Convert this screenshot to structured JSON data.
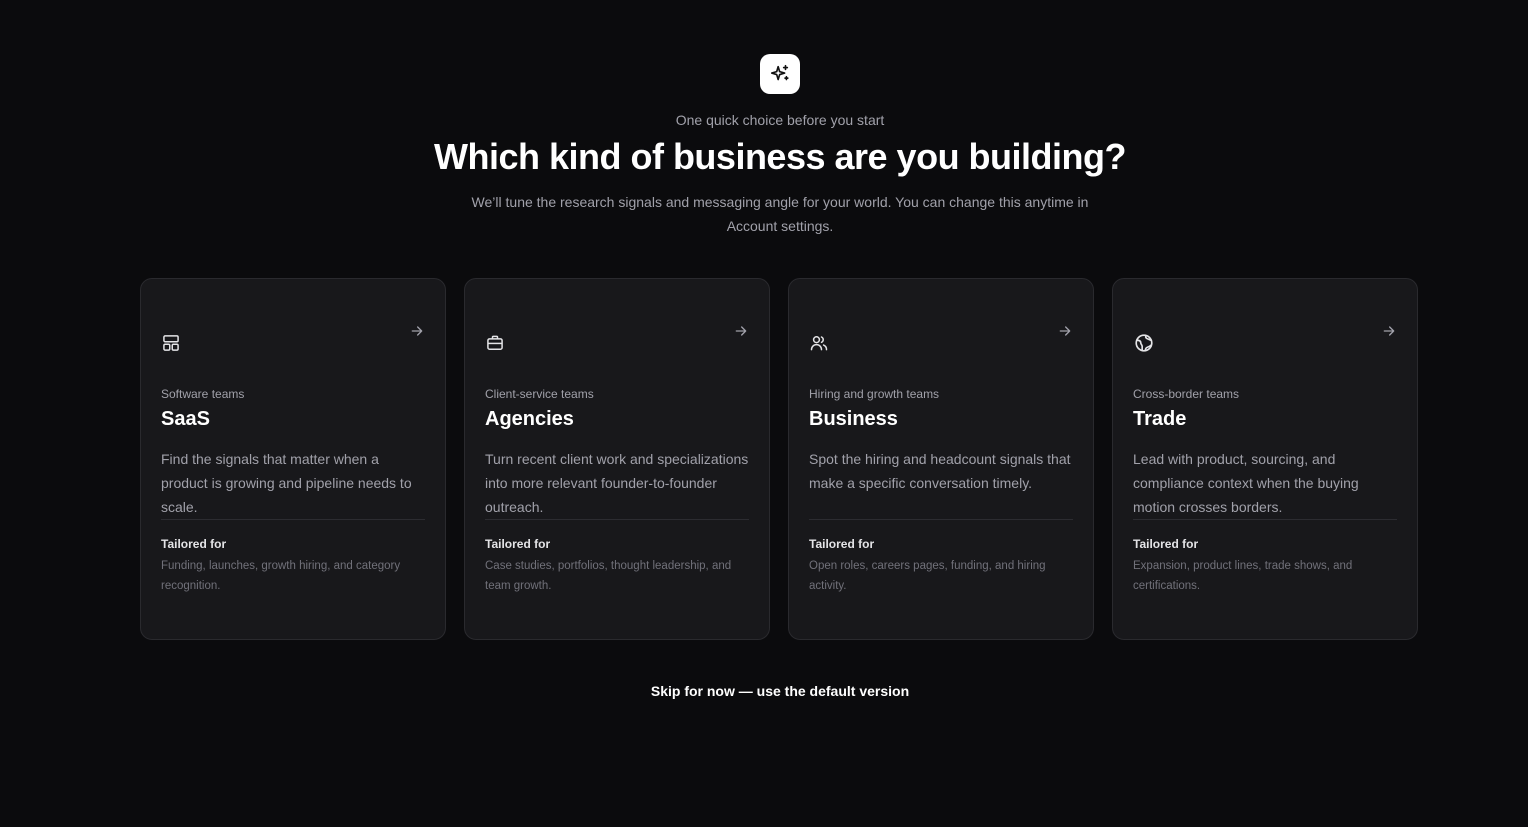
{
  "header": {
    "logo_icon": "sparkles-icon",
    "eyebrow": "One quick choice before you start",
    "title": "Which kind of business are you building?",
    "subtitle": "We’ll tune the research signals and messaging angle for your world. You can change this anytime in Account settings."
  },
  "cards": [
    {
      "icon": "layout-grid-icon",
      "kicker": "Software teams",
      "title": "SaaS",
      "description": "Find the signals that matter when a product is growing and pipeline needs to scale.",
      "tailored_label": "Tailored for",
      "tailored_text": "Funding, launches, growth hiring, and category recognition."
    },
    {
      "icon": "briefcase-icon",
      "kicker": "Client-service teams",
      "title": "Agencies",
      "description": "Turn recent client work and specializations into more relevant founder-to-founder outreach.",
      "tailored_label": "Tailored for",
      "tailored_text": "Case studies, portfolios, thought leadership, and team growth."
    },
    {
      "icon": "users-icon",
      "kicker": "Hiring and growth teams",
      "title": "Business",
      "description": "Spot the hiring and headcount signals that make a specific conversation timely.",
      "tailored_label": "Tailored for",
      "tailored_text": "Open roles, careers pages, funding, and hiring activity."
    },
    {
      "icon": "globe-icon",
      "kicker": "Cross-border teams",
      "title": "Trade",
      "description": "Lead with product, sourcing, and compliance context when the buying motion crosses borders.",
      "tailored_label": "Tailored for",
      "tailored_text": "Expansion, product lines, trade shows, and certifications."
    }
  ],
  "footer": {
    "skip_label": "Skip for now — use the default version"
  }
}
